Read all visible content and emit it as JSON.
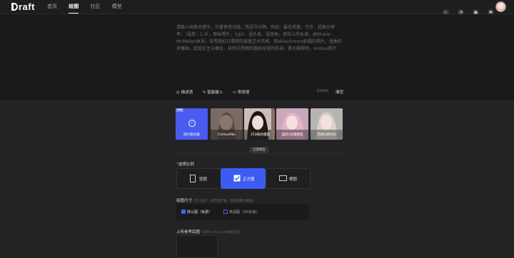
{
  "header": {
    "logo": "raft",
    "nav": [
      "首页",
      "绘图",
      "社区",
      "模型"
    ],
    "active_nav": "绘图",
    "icons": [
      "search-icon",
      "bell-icon",
      "gallery-icon",
      "settings-icon"
    ]
  },
  "prompt": {
    "placeholder": "请输入画面关键字，尽量使用词组，用逗号分隔。例如：最佳质量，杰作，超高分辨率，（逼真：1.4），原始照片，1girl，湿头发，湿身体，皮肤上的水滴，由Shane McMellen执导，采用霓虹灯照明的波普艺术风格，用ektachrome拍摄的照片，扭曲的肖像画，超现实主义概念，奇特式黑暗和喜剧无常的色调，柔光箱照明，Imstax照片",
    "tools": [
      "描述语",
      "智能输入",
      "常用语"
    ],
    "counter": "0/600",
    "clear_label": "清空"
  },
  "models": {
    "items": [
      {
        "label": "图片融合器",
        "tag": "专属",
        "selected": true
      },
      {
        "label": "ChilloutMix",
        "tag": "",
        "selected": false
      },
      {
        "label": "25D融合模型",
        "tag": "",
        "selected": false
      },
      {
        "label": "国风3动漫模型",
        "tag": "",
        "selected": false
      },
      {
        "label": "无邪幻想V60",
        "tag": "",
        "selected": false
      }
    ],
    "expand_label": "全部模型"
  },
  "ratio": {
    "title": "选择比例",
    "options": [
      {
        "label": "竖图",
        "selected": false
      },
      {
        "label": "正方图",
        "selected": true
      },
      {
        "label": "横图",
        "selected": false
      }
    ]
  },
  "size": {
    "title": "绘图尺寸",
    "hint": "(尺寸越大，细节越丰富，但消耗算力越多)",
    "options": [
      {
        "label": "默认图（免费）",
        "selected": true
      },
      {
        "label": "高清图（20点/张）",
        "selected": false
      }
    ]
  },
  "upload": {
    "title": "上传参考底图",
    "hint": "(支持control net智能扩图)"
  },
  "colors": {
    "accent": "#3b5bf2",
    "background": "#232325",
    "panel": "#1a1a1b"
  }
}
